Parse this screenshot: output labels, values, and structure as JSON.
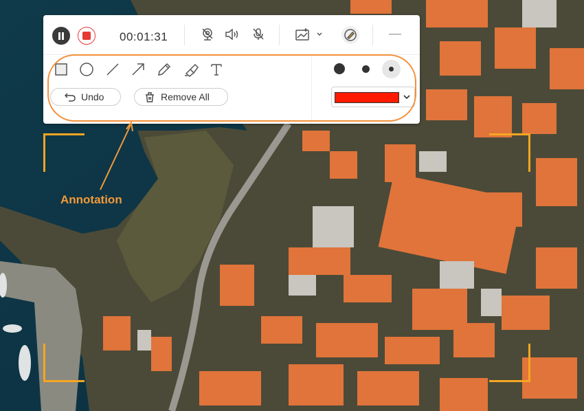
{
  "toolbar": {
    "timer": "00:01:31",
    "undo_label": "Undo",
    "remove_all_label": "Remove All",
    "selected_color": "#ff1a00",
    "accent_stop": "#e53935"
  },
  "annotation_callout": {
    "label": "Annotation",
    "color": "#f39a38"
  },
  "icons": {
    "pause": "pause-icon",
    "stop": "stop-icon",
    "webcam": "webcam-icon",
    "speaker": "speaker-icon",
    "microphone": "microphone-muted-icon",
    "screenshot": "screenshot-icon",
    "annotate": "annotate-icon",
    "minimize": "minimize-icon",
    "rectangle": "rectangle-tool-icon",
    "ellipse": "ellipse-tool-icon",
    "line": "line-tool-icon",
    "arrow": "arrow-tool-icon",
    "pencil": "pencil-tool-icon",
    "highlighter": "highlighter-tool-icon",
    "text": "text-tool-icon"
  }
}
